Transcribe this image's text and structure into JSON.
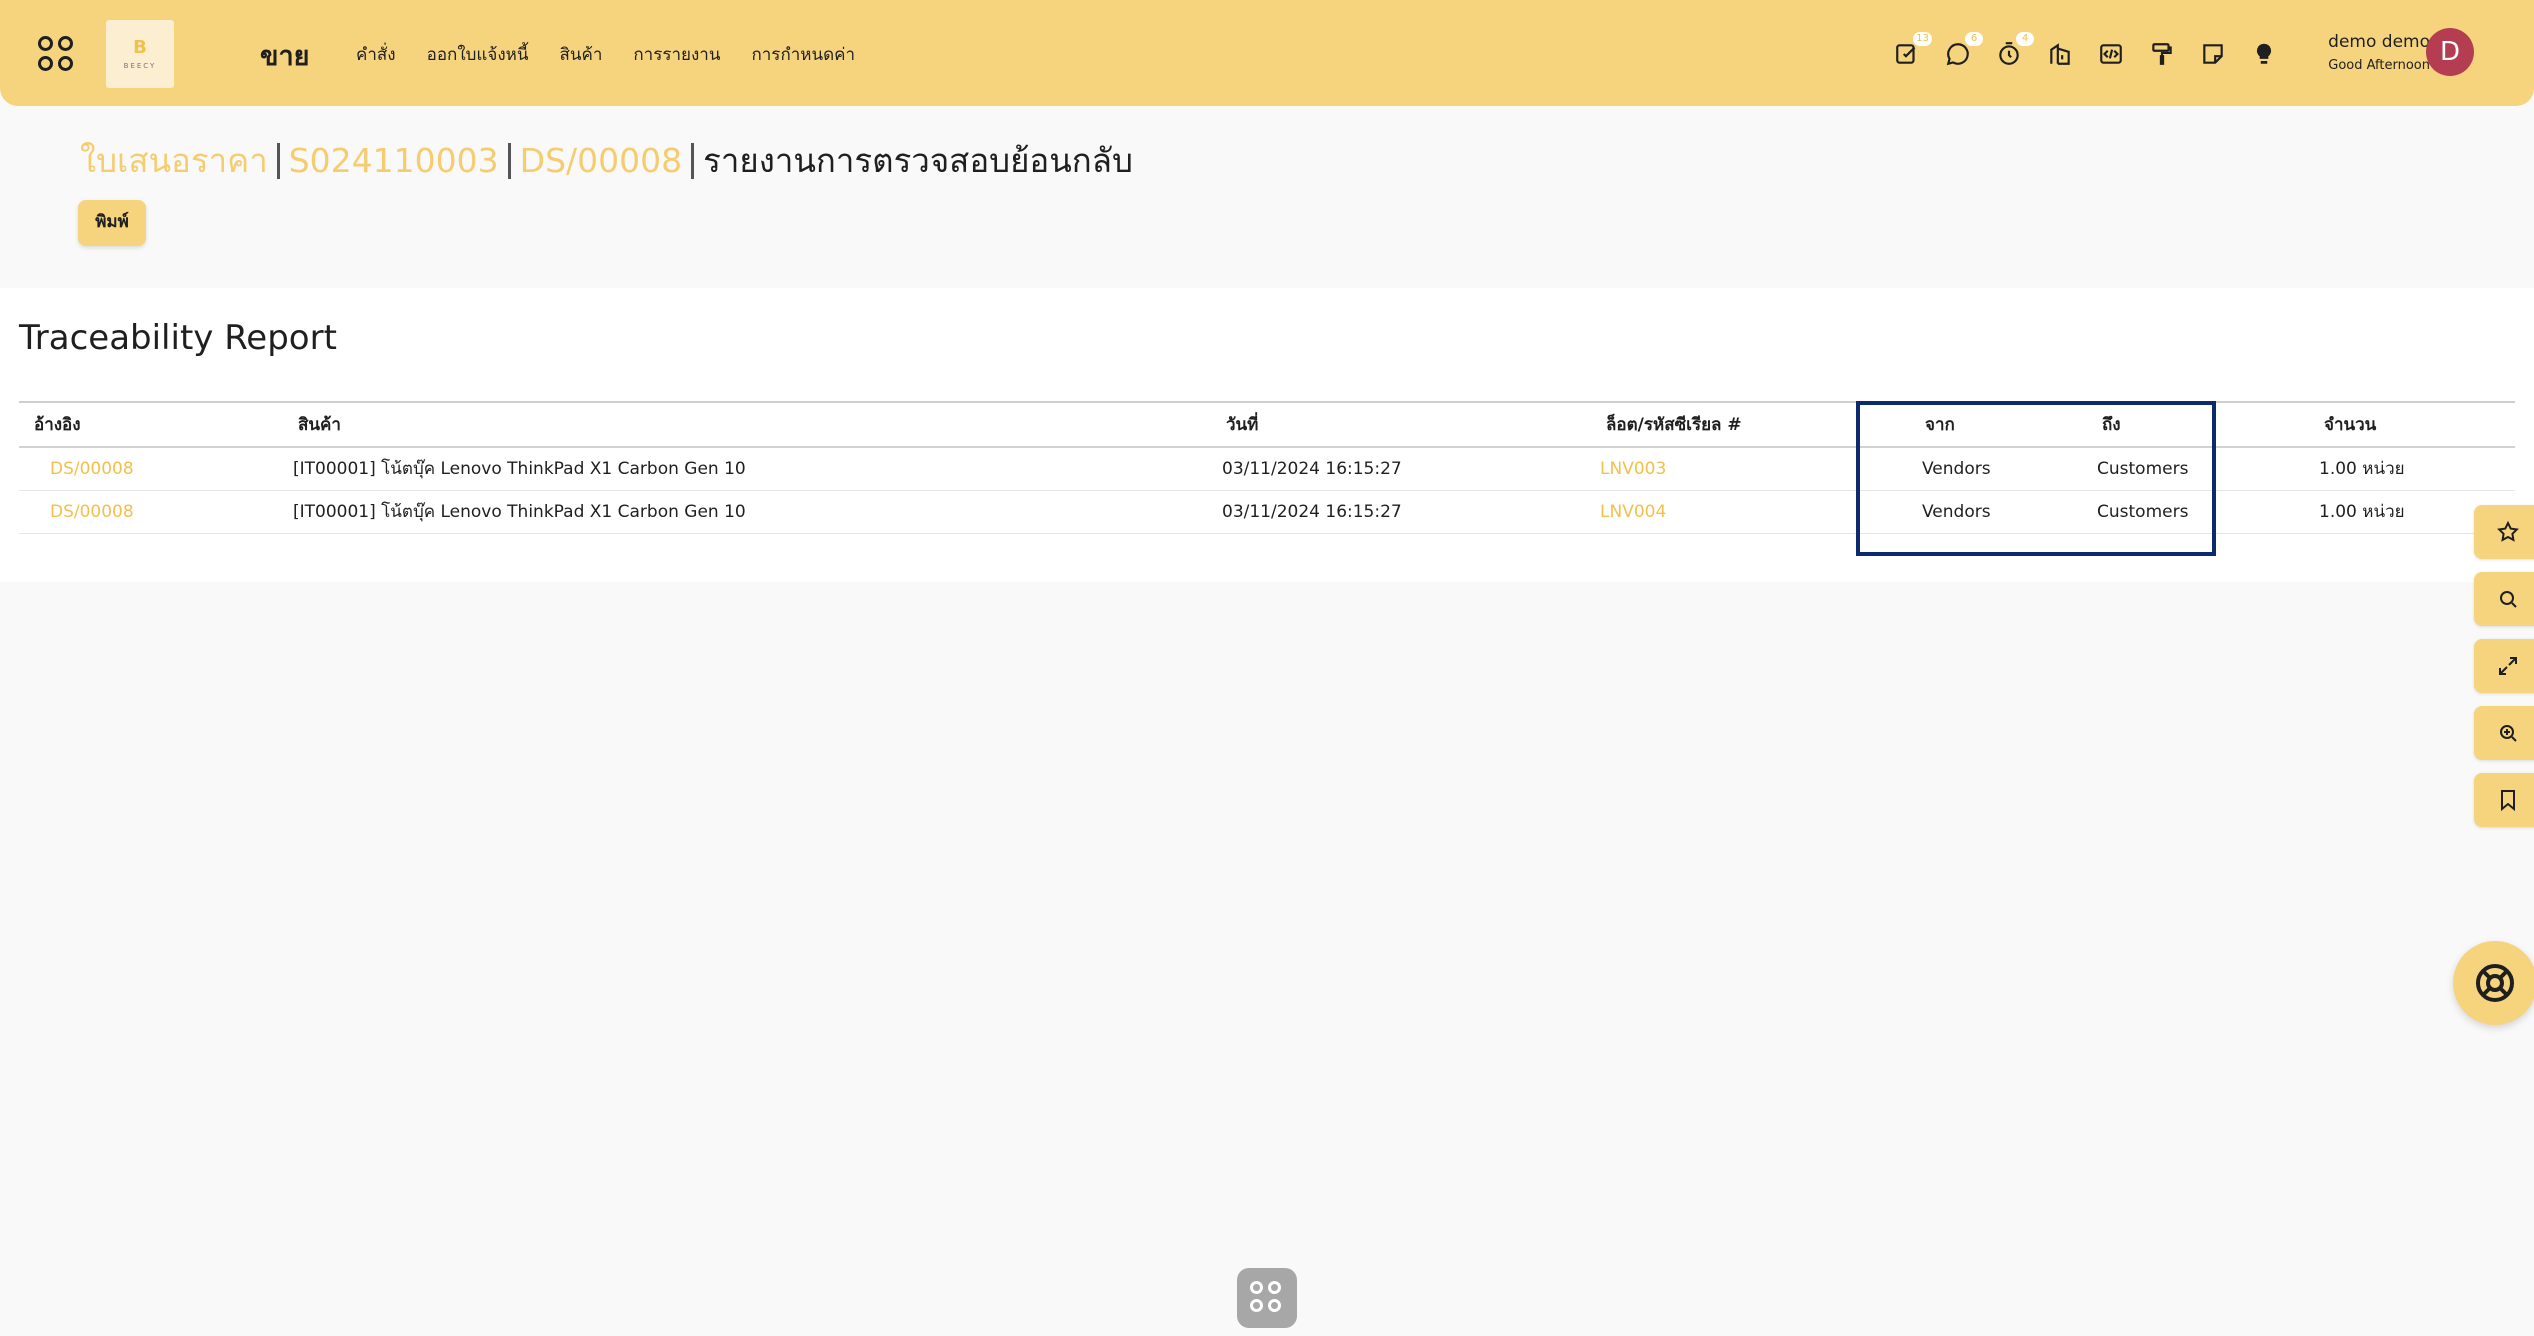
{
  "nav": {
    "app_name": "ขาย",
    "logo_letter": "B",
    "logo_text": "BEECY",
    "menu": [
      "คำสั่ง",
      "ออกใบแจ้งหนี้",
      "สินค้า",
      "การรายงาน",
      "การกำหนดค่า"
    ],
    "badges": {
      "activity": "13",
      "messages": "6",
      "timer": "4"
    },
    "user_name": "demo demo",
    "greeting": "Good Afternoon",
    "avatar_letter": "D"
  },
  "breadcrumb": {
    "items": [
      "ใบเสนอราคา",
      "S024110003",
      "DS/00008"
    ],
    "current": "รายงานการตรวจสอบย้อนกลับ"
  },
  "actions": {
    "print_label": "พิมพ์"
  },
  "report": {
    "title": "Traceability Report",
    "columns": {
      "reference": "อ้างอิง",
      "product": "สินค้า",
      "date": "วันที่",
      "lot": "ล็อต/รหัสซีเรียล #",
      "from": "จาก",
      "to": "ถึง",
      "quantity": "จำนวน"
    },
    "rows": [
      {
        "reference": "DS/00008",
        "product": "[IT00001] โน้ตบุ๊ค Lenovo ThinkPad X1 Carbon Gen 10",
        "date": "03/11/2024 16:15:27",
        "lot": "LNV003",
        "from": "Vendors",
        "to": "Customers",
        "quantity": "1.00 หน่วย"
      },
      {
        "reference": "DS/00008",
        "product": "[IT00001] โน้ตบุ๊ค Lenovo ThinkPad X1 Carbon Gen 10",
        "date": "03/11/2024 16:15:27",
        "lot": "LNV004",
        "from": "Vendors",
        "to": "Customers",
        "quantity": "1.00 หน่วย"
      }
    ]
  },
  "colors": {
    "accent": "#f6d47e",
    "link": "#f2c04c",
    "avatar": "#b43d52",
    "highlight": "#0d2a6c"
  }
}
